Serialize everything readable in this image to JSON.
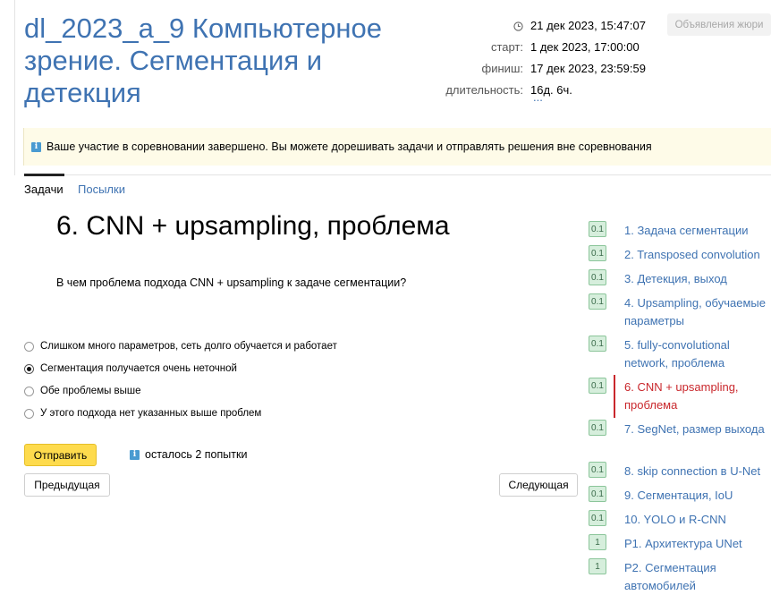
{
  "contest": {
    "title": "dl_2023_a_9 Компьютерное зрение. Сегментация и детекция",
    "current_time": "21 дек 2023, 15:47:07",
    "start_label": "старт:",
    "start_value": "1 дек 2023, 17:00:00",
    "finish_label": "финиш:",
    "finish_value": "17 дек 2023, 23:59:59",
    "duration_label": "длительность:",
    "duration_value": "16д. 6ч.",
    "more_link": "...",
    "jury_button": "Объявления жюри"
  },
  "notice": {
    "icon": "info-icon",
    "text": "Ваше участие в соревновании завершено. Вы можете дорешивать задачи и отправлять решения вне соревнования"
  },
  "tabs": [
    {
      "label": "Задачи",
      "active": true
    },
    {
      "label": "Посылки",
      "active": false
    }
  ],
  "task": {
    "title": "6. CNN + upsampling, проблема",
    "question": "В чем проблема подхода CNN + upsampling к задаче сегментации?",
    "options": [
      {
        "label": "Слишком много параметров, сеть долго обучается и работает",
        "selected": false
      },
      {
        "label": "Сегментация получается очень неточной",
        "selected": true
      },
      {
        "label": "Обе проблемы выше",
        "selected": false
      },
      {
        "label": "У этого подхода нет указанных выше проблем",
        "selected": false
      }
    ],
    "submit_label": "Отправить",
    "attempts_text": "осталось 2 попытки",
    "prev_label": "Предыдущая",
    "next_label": "Следующая"
  },
  "sidebar": {
    "items": [
      {
        "score": "0.1",
        "label": "1. Задача сегментации",
        "current": false
      },
      {
        "score": "0.1",
        "label": "2. Transposed convolution",
        "current": false
      },
      {
        "score": "0.1",
        "label": "3. Детекция, выход",
        "current": false
      },
      {
        "score": "0.1",
        "label": "4. Upsampling, обучаемые параметры",
        "current": false
      },
      {
        "score": "0.1",
        "label": "5. fully-convolutional network, проблема",
        "current": false
      },
      {
        "score": "0.1",
        "label": "6. CNN + upsampling, проблема",
        "current": true
      },
      {
        "score": "0.1",
        "label": "7. SegNet, размер выхода",
        "current": false
      },
      {
        "score": "0.1",
        "label": "8. skip connection в U-Net",
        "current": false
      },
      {
        "score": "0.1",
        "label": "9. Сегментация, IoU",
        "current": false
      },
      {
        "score": "0.1",
        "label": "10. YOLO и R-CNN",
        "current": false
      },
      {
        "score": "1",
        "label": "P1. Архитектура UNet",
        "current": false
      },
      {
        "score": "1",
        "label": "P2. Сегментация автомобилей",
        "current": false
      }
    ]
  },
  "colors": {
    "link": "#3f73b2",
    "current": "#c9272c",
    "submit": "#fedb4d",
    "score_bg": "#d6eedc"
  }
}
